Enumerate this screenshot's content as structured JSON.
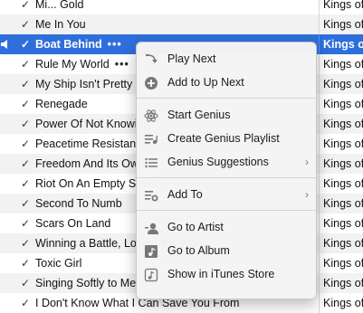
{
  "tracks": [
    {
      "name": "Mi... Gold",
      "artist": "Kings of Leon",
      "checked": true
    },
    {
      "name": "Me In You",
      "artist": "Kings of Leon",
      "checked": true
    },
    {
      "name": "Boat Behind",
      "artist": "Kings of Leon",
      "checked": true,
      "selected": true,
      "playing": true,
      "more": "•••"
    },
    {
      "name": "Rule My World",
      "artist": "Kings of Leon",
      "checked": true,
      "more": "•••"
    },
    {
      "name": "My Ship Isn't Pretty",
      "artist": "Kings of Leon",
      "checked": true
    },
    {
      "name": "Renegade",
      "artist": "Kings of Leon",
      "checked": true
    },
    {
      "name": "Power Of Not Knowing",
      "artist": "Kings of Leon",
      "checked": true
    },
    {
      "name": "Peacetime Resistance",
      "artist": "Kings of Leon",
      "checked": true
    },
    {
      "name": "Freedom And Its Owner",
      "artist": "Kings of Leon",
      "checked": true
    },
    {
      "name": "Riot On An Empty Street",
      "artist": "Kings of Leon",
      "checked": true
    },
    {
      "name": "Second To Numb",
      "artist": "Kings of Leon",
      "checked": true
    },
    {
      "name": "Scars On Land",
      "artist": "Kings of Leon",
      "checked": true
    },
    {
      "name": "Winning a Battle, Losing the War",
      "artist": "Kings of Leon",
      "checked": true
    },
    {
      "name": "Toxic Girl",
      "artist": "Kings of Leon",
      "checked": true
    },
    {
      "name": "Singing Softly to Me",
      "artist": "Kings of Leon",
      "checked": true
    },
    {
      "name": "I Don't Know What I Can Save You From",
      "artist": "Kings of Leon",
      "checked": true
    }
  ],
  "checkmark": "✓",
  "menu": {
    "items": [
      {
        "label": "Play Next",
        "icon": "play-next-icon"
      },
      {
        "label": "Add to Up Next",
        "icon": "add-up-next-icon"
      },
      {
        "label": "Start Genius",
        "icon": "genius-icon"
      },
      {
        "label": "Create Genius Playlist",
        "icon": "genius-playlist-icon"
      },
      {
        "label": "Genius Suggestions",
        "icon": "genius-suggestions-icon",
        "submenu": "›"
      },
      {
        "label": "Add To",
        "icon": "add-to-icon",
        "submenu": "›"
      },
      {
        "label": "Go to Artist",
        "icon": "artist-icon"
      },
      {
        "label": "Go to Album",
        "icon": "album-icon"
      },
      {
        "label": "Show in iTunes Store",
        "icon": "itunes-store-icon"
      }
    ]
  },
  "colors": {
    "selection": "#2e6fdb",
    "alt_row": "#f2f2f2"
  }
}
